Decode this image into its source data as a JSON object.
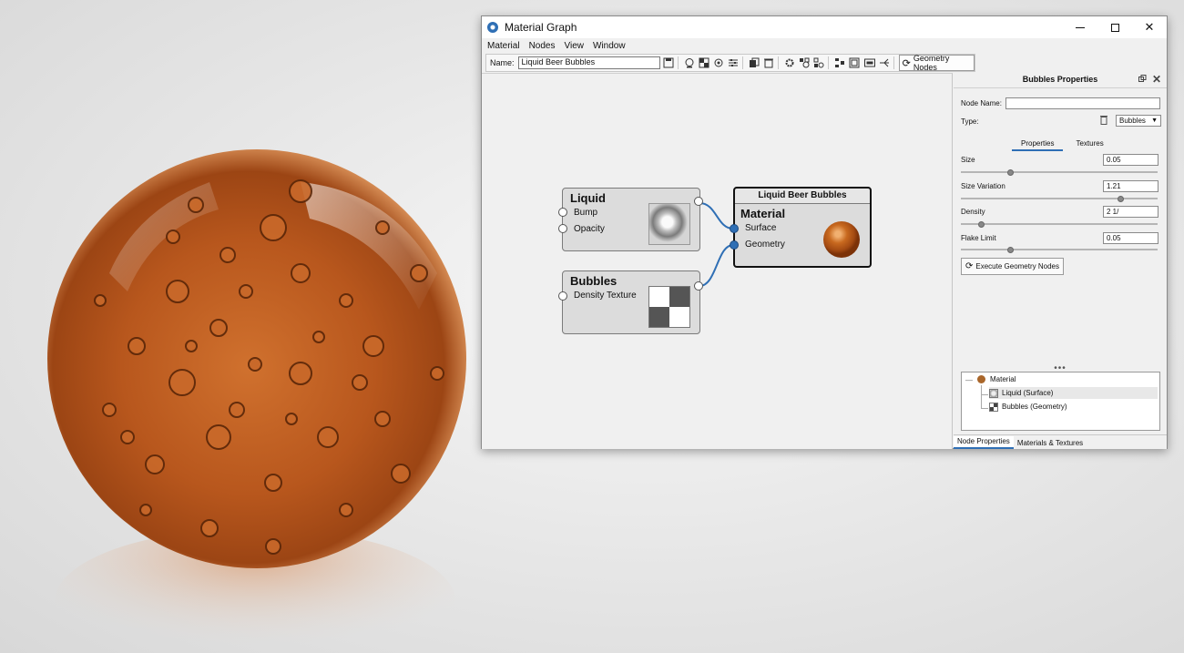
{
  "window": {
    "title": "Material Graph",
    "controls": {
      "minimize": "",
      "maximize": "",
      "close": "✕"
    }
  },
  "menu": [
    "Material",
    "Nodes",
    "View",
    "Window"
  ],
  "toolbar": {
    "name_label": "Name:",
    "name_value": "Liquid Beer Bubbles",
    "geometry_nodes_label": "Geometry Nodes"
  },
  "graph": {
    "liquid_node": {
      "title": "Liquid",
      "inputs": [
        "Bump",
        "Opacity"
      ]
    },
    "bubbles_node": {
      "title": "Bubbles",
      "inputs": [
        "Density Texture"
      ]
    },
    "material_node": {
      "header": "Liquid Beer Bubbles",
      "title": "Material",
      "inputs": [
        "Surface",
        "Geometry"
      ]
    }
  },
  "panel": {
    "title": "Bubbles Properties",
    "node_name_label": "Node Name:",
    "node_name_value": "",
    "type_label": "Type:",
    "type_value": "Bubbles",
    "tabs": [
      "Properties",
      "Textures"
    ],
    "properties": [
      {
        "label": "Size",
        "value": "0.05",
        "slider": 0.25
      },
      {
        "label": "Size Variation",
        "value": "1.21",
        "slider": 0.81
      },
      {
        "label": "Density",
        "value": "2 1/",
        "slider": 0.1
      },
      {
        "label": "Flake Limit",
        "value": "0.05",
        "slider": 0.25
      }
    ],
    "execute_button": "Execute Geometry Nodes",
    "tree": {
      "root": "Material",
      "children": [
        "Liquid (Surface)",
        "Bubbles (Geometry)"
      ]
    },
    "bottom_tabs": [
      "Node Properties",
      "Materials & Textures"
    ]
  },
  "colors": {
    "accent": "#2f6fb5",
    "amber": "#b0561d",
    "material_dot": "#a9662a"
  },
  "icons": [
    "app-icon",
    "save-icon",
    "sphere-icon",
    "checker-icon",
    "refresh-icon",
    "sliders-icon",
    "copy-icon",
    "trash-icon",
    "gear-icon",
    "layout-icon",
    "fit-icon",
    "zoom-100-icon",
    "share-icon"
  ]
}
